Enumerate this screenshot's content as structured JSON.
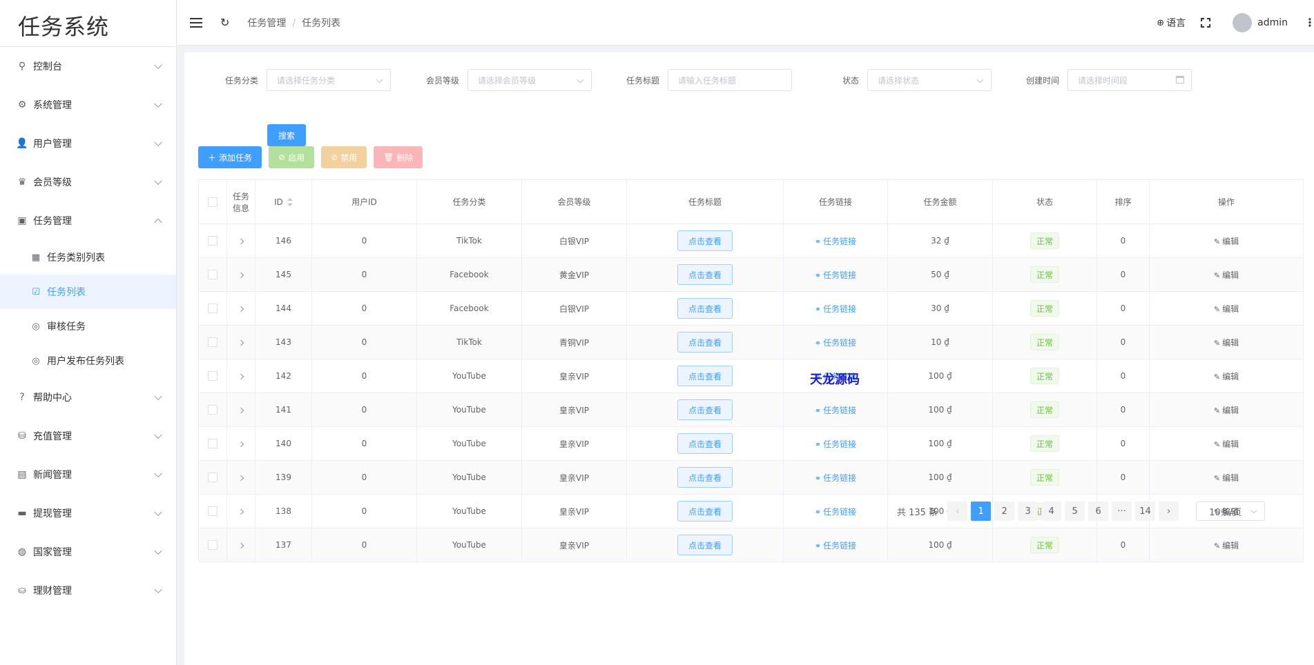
{
  "app": {
    "title": "任务系统"
  },
  "sidebar": {
    "items": [
      {
        "label": "控制台",
        "icon": "dashboard-icon"
      },
      {
        "label": "系统管理",
        "icon": "gear-icon"
      },
      {
        "label": "用户管理",
        "icon": "user-icon"
      },
      {
        "label": "会员等级",
        "icon": "crown-icon"
      },
      {
        "label": "任务管理",
        "icon": "task-icon",
        "expanded": true,
        "children": [
          {
            "label": "任务类别列表",
            "icon": "grid-icon"
          },
          {
            "label": "任务列表",
            "icon": "clipboard-icon",
            "active": true
          },
          {
            "label": "审核任务",
            "icon": "check-circle-icon"
          },
          {
            "label": "用户发布任务列表",
            "icon": "check-circle-icon"
          }
        ]
      },
      {
        "label": "帮助中心",
        "icon": "help-icon"
      },
      {
        "label": "充值管理",
        "icon": "recharge-icon"
      },
      {
        "label": "新闻管理",
        "icon": "news-icon"
      },
      {
        "label": "提现管理",
        "icon": "wallet-icon"
      },
      {
        "label": "国家管理",
        "icon": "globe-icon"
      },
      {
        "label": "理财管理",
        "icon": "coins-icon"
      }
    ]
  },
  "header": {
    "breadcrumb": [
      "任务管理",
      "任务列表"
    ],
    "language_label": "语言",
    "username": "admin"
  },
  "filters": {
    "category": {
      "label": "任务分类",
      "placeholder": "请选择任务分类"
    },
    "level": {
      "label": "会员等级",
      "placeholder": "请选择会员等级"
    },
    "title": {
      "label": "任务标题",
      "placeholder": "请输入任务标题"
    },
    "status": {
      "label": "状态",
      "placeholder": "请选择状态"
    },
    "created": {
      "label": "创建时间",
      "placeholder": "请选择时间段"
    },
    "search_label": "搜索"
  },
  "toolbar": {
    "add_label": "添加任务",
    "enable_label": "启用",
    "disable_label": "禁用",
    "delete_label": "删除"
  },
  "table": {
    "columns": [
      "任务信息",
      "ID",
      "用户ID",
      "任务分类",
      "会员等级",
      "任务标题",
      "任务链接",
      "任务金额",
      "状态",
      "排序",
      "操作"
    ],
    "view_label": "点击查看",
    "link_label": "任务链接",
    "edit_label": "编辑",
    "rows": [
      {
        "id": "146",
        "user_id": "0",
        "category": "TikTok",
        "level": "白银VIP",
        "amount": "32 ₫",
        "status": "正常",
        "sort": "0"
      },
      {
        "id": "145",
        "user_id": "0",
        "category": "Facebook",
        "level": "黄金VIP",
        "amount": "50 ₫",
        "status": "正常",
        "sort": "0"
      },
      {
        "id": "144",
        "user_id": "0",
        "category": "Facebook",
        "level": "白银VIP",
        "amount": "30 ₫",
        "status": "正常",
        "sort": "0"
      },
      {
        "id": "143",
        "user_id": "0",
        "category": "TikTok",
        "level": "青铜VIP",
        "amount": "10 ₫",
        "status": "正常",
        "sort": "0"
      },
      {
        "id": "142",
        "user_id": "0",
        "category": "YouTube",
        "level": "皇亲VIP",
        "amount": "100 ₫",
        "status": "正常",
        "sort": "0"
      },
      {
        "id": "141",
        "user_id": "0",
        "category": "YouTube",
        "level": "皇亲VIP",
        "amount": "100 ₫",
        "status": "正常",
        "sort": "0"
      },
      {
        "id": "140",
        "user_id": "0",
        "category": "YouTube",
        "level": "皇亲VIP",
        "amount": "100 ₫",
        "status": "正常",
        "sort": "0"
      },
      {
        "id": "139",
        "user_id": "0",
        "category": "YouTube",
        "level": "皇亲VIP",
        "amount": "100 ₫",
        "status": "正常",
        "sort": "0"
      },
      {
        "id": "138",
        "user_id": "0",
        "category": "YouTube",
        "level": "皇亲VIP",
        "amount": "100 ₫",
        "status": "正常",
        "sort": "0"
      },
      {
        "id": "137",
        "user_id": "0",
        "category": "YouTube",
        "level": "皇亲VIP",
        "amount": "100 ₫",
        "status": "正常",
        "sort": "0"
      }
    ]
  },
  "pagination": {
    "total_label": "共 135 条",
    "pages": [
      "1",
      "2",
      "3",
      "4",
      "5",
      "6",
      "···",
      "14"
    ],
    "current": "1",
    "page_size_label": "10条/页"
  },
  "watermark": "天龙源码",
  "colors": {
    "primary": "#409eff",
    "success": "#67c23a",
    "warning": "#e6a23c",
    "danger": "#f56c6c"
  }
}
